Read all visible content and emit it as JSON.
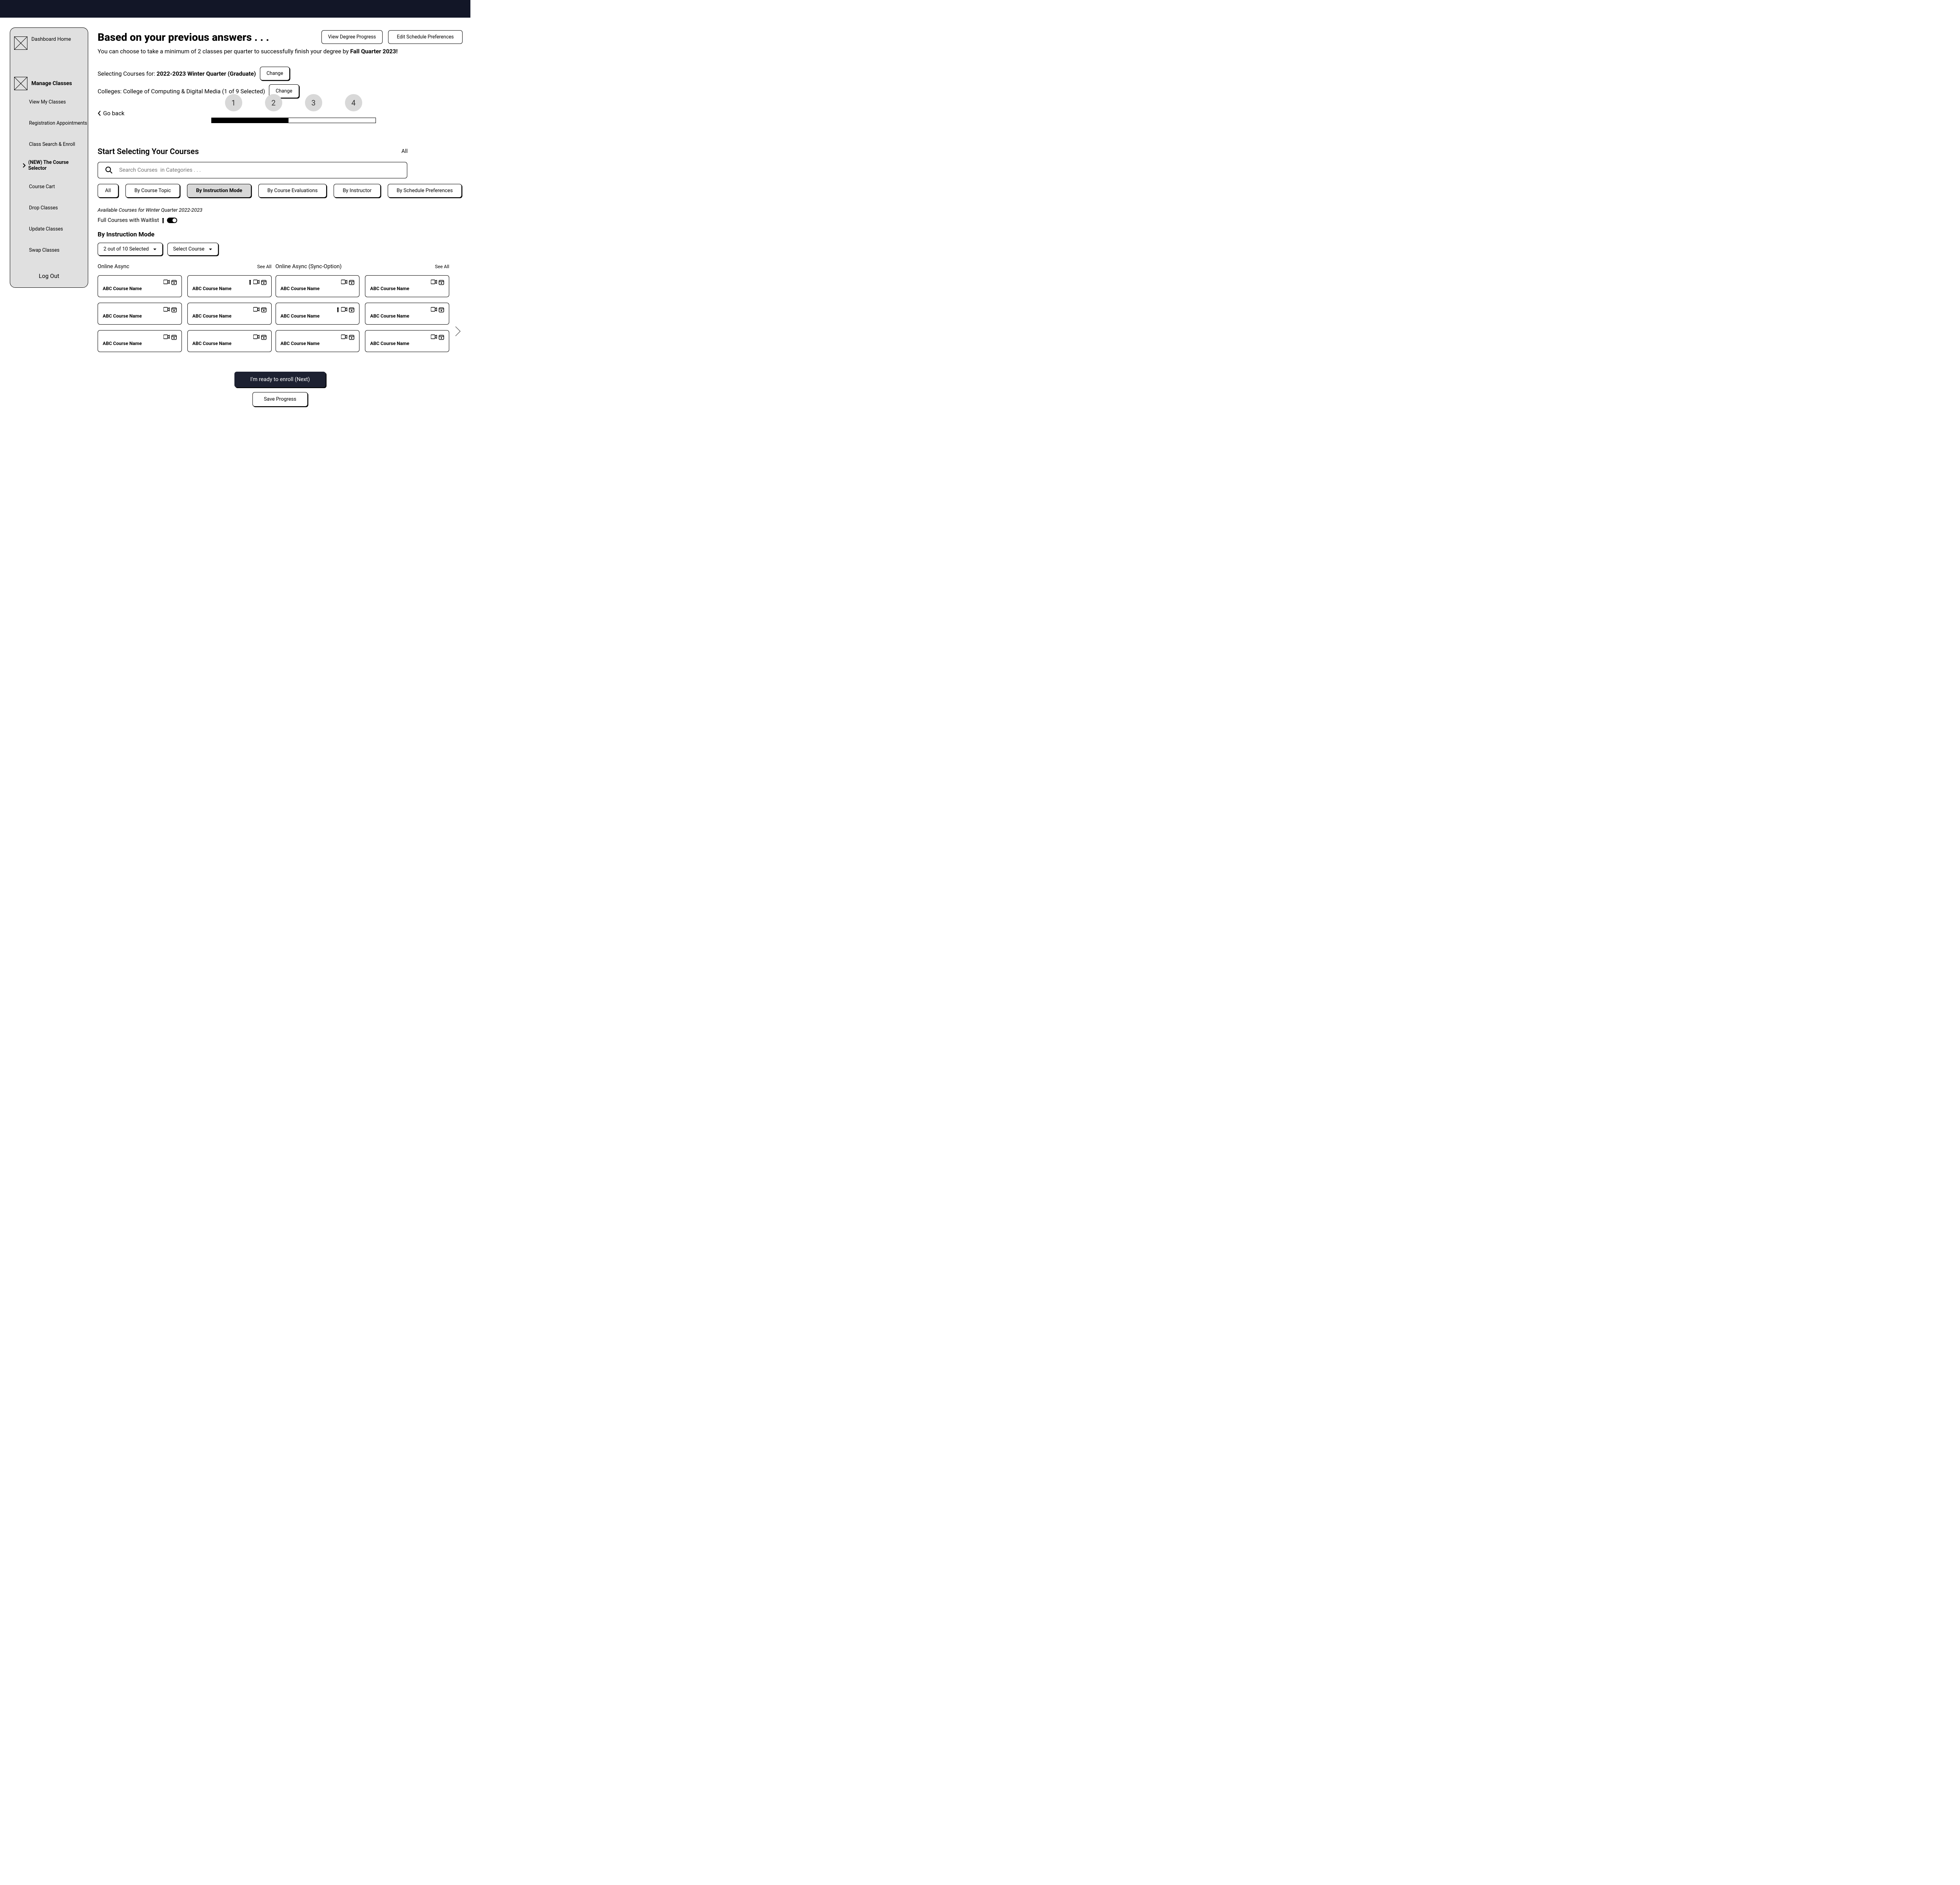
{
  "sidebar": {
    "home": "Dashboard Home",
    "manage": "Manage Classes",
    "subs": [
      "View My Classes",
      "Registration Appointments",
      "Class Search & Enroll",
      "(NEW) The Course Selector",
      "Course Cart",
      "Drop Classes",
      "Update Classes",
      "Swap Classes"
    ],
    "logout": "Log Out"
  },
  "header": {
    "title": "Based on your previous answers . . .",
    "view_progress": "View Degree Progress",
    "edit_prefs": "Edit Schedule Preferences",
    "subtitle_pre": "You can choose to take a minimum of 2 classes per quarter to successfully finish your degree by ",
    "subtitle_bold": "Fall Quarter 2023!"
  },
  "selector": {
    "course_label_pre": "Selecting Courses for: ",
    "course_label_bold": "2022-2023 Winter Quarter (Graduate)",
    "change": "Change",
    "college_label": "Colleges: College of Computing & Digital Media (1 of 9 Selected)"
  },
  "go_back": "Go back",
  "steps": [
    "1",
    "2",
    "3",
    "4"
  ],
  "section": {
    "title": "Start Selecting Your Courses",
    "all": "All",
    "search_placeholder": "Search Courses  in Categories . . ."
  },
  "filters": {
    "all": "All",
    "topic": "By Course Topic",
    "instruction": "By Instruction Mode",
    "evals": "By Course Evaluations",
    "instructor": "By Instructor",
    "schedule": "By Schedule Preferences"
  },
  "available": "Available Courses for Winter Quarter 2022-2023",
  "waitlist": "Full Courses with Waitlist",
  "subsection": "By Instruction Mode",
  "dropdowns": {
    "selected": "2 out of 10 Selected",
    "select_course": "Select Course"
  },
  "columns": {
    "col1": "Online Async",
    "col2": "Online Async (Sync-Option)",
    "see_all": "See All"
  },
  "card_name": "ABC Course Name",
  "bottom": {
    "next": "I'm ready to enroll (Next)",
    "save": "Save Progress"
  }
}
